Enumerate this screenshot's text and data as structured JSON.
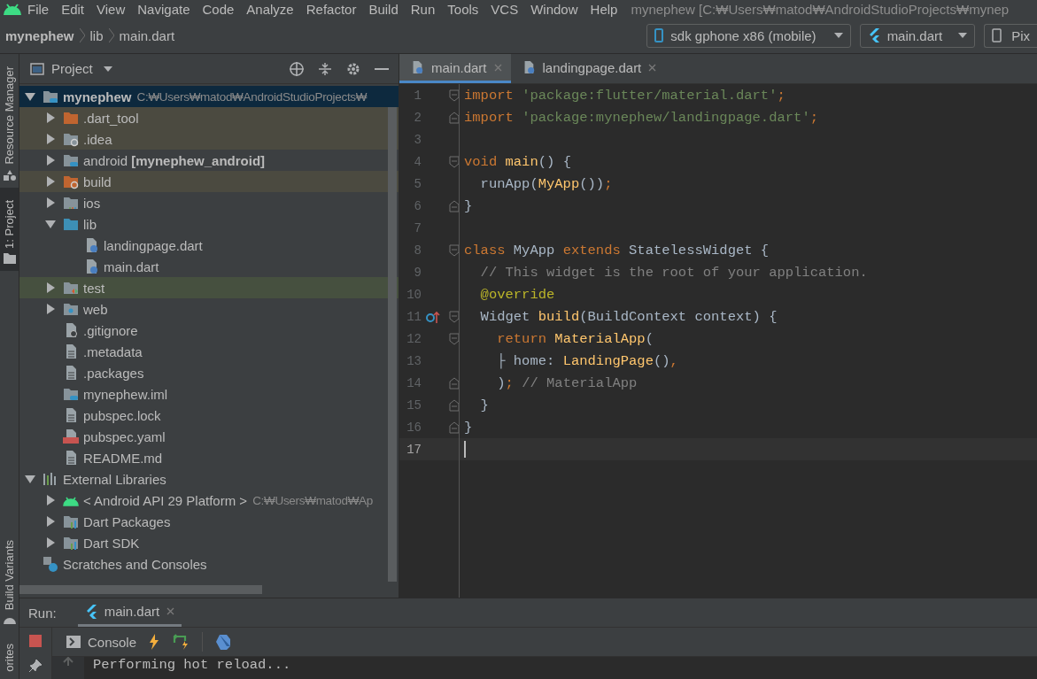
{
  "menu": [
    "File",
    "Edit",
    "View",
    "Navigate",
    "Code",
    "Analyze",
    "Refactor",
    "Build",
    "Run",
    "Tools",
    "VCS",
    "Window",
    "Help"
  ],
  "window": {
    "title": "mynephew [C:₩Users₩matod₩AndroidStudioProjects₩mynep"
  },
  "breadcrumbs": [
    "mynephew",
    "lib",
    "main.dart"
  ],
  "run_toolbar": {
    "device": "sdk gphone x86 (mobile)",
    "configuration": "main.dart",
    "next_label": "Pix"
  },
  "side_strip_top": [
    {
      "label": "Resource Manager",
      "kind": "resources",
      "selected": false
    },
    {
      "label": "1: Project",
      "kind": "project",
      "selected": true
    }
  ],
  "side_strip_bottom": [
    {
      "label": "Build Variants",
      "kind": "variants",
      "selected": false
    },
    {
      "label": "orites",
      "kind": "favorites",
      "selected": false
    }
  ],
  "project_panel": {
    "title": "Project",
    "tree": [
      {
        "label": "mynephew",
        "kind": "project-folder",
        "path": "C:₩Users₩matod₩AndroidStudioProjects₩",
        "expanded": true,
        "selected": true,
        "children": [
          {
            "label": ".dart_tool",
            "kind": "folder-excluded",
            "excluded": true,
            "test_source": false,
            "expanded": false,
            "selected": false
          },
          {
            "label": ".idea",
            "kind": "folder-config",
            "excluded": true,
            "test_source": false,
            "expanded": false,
            "selected": false
          },
          {
            "label": "android **[mynephew_android]**",
            "kind": "module-folder",
            "excluded": false,
            "test_source": false,
            "expanded": false,
            "selected": false
          },
          {
            "label": "build",
            "kind": "folder-build",
            "excluded": true,
            "test_source": false,
            "expanded": false,
            "selected": false
          },
          {
            "label": "ios",
            "kind": "folder-ios",
            "excluded": false,
            "test_source": false,
            "expanded": false,
            "selected": false
          },
          {
            "label": "lib",
            "kind": "folder",
            "excluded": false,
            "test_source": false,
            "expanded": true,
            "selected": false,
            "children": [
              {
                "label": "landingpage.dart",
                "kind": "dart-file",
                "selected": false
              },
              {
                "label": "main.dart",
                "kind": "dart-file",
                "selected": false
              }
            ]
          },
          {
            "label": "test",
            "kind": "folder-test",
            "excluded": false,
            "test_source": true,
            "expanded": false,
            "selected": false
          },
          {
            "label": "web",
            "kind": "folder-web",
            "excluded": false,
            "test_source": false,
            "expanded": false,
            "selected": false
          },
          {
            "label": ".gitignore",
            "kind": "ignore-file",
            "excluded": false,
            "test_source": false,
            "selected": false
          },
          {
            "label": ".metadata",
            "kind": "text-file",
            "excluded": false,
            "test_source": false,
            "selected": false
          },
          {
            "label": ".packages",
            "kind": "text-file",
            "excluded": false,
            "test_source": false,
            "selected": false
          },
          {
            "label": "mynephew.iml",
            "kind": "module-file",
            "excluded": false,
            "test_source": false,
            "selected": false
          },
          {
            "label": "pubspec.lock",
            "kind": "text-file",
            "excluded": false,
            "test_source": false,
            "selected": false
          },
          {
            "label": "pubspec.yaml",
            "kind": "yaml-file",
            "excluded": false,
            "test_source": false,
            "selected": false
          },
          {
            "label": "README.md",
            "kind": "text-file",
            "excluded": false,
            "test_source": false,
            "selected": false
          }
        ]
      },
      {
        "label": "External Libraries",
        "kind": "libraries",
        "expanded": true,
        "selected": false,
        "children": [
          {
            "label": "< Android API 29 Platform >",
            "kind": "android-sdk",
            "path": "C:₩Users₩matod₩Ap",
            "expanded": false,
            "selected": false
          },
          {
            "label": "Dart Packages",
            "kind": "library",
            "expanded": false,
            "selected": false
          },
          {
            "label": "Dart SDK",
            "kind": "library",
            "expanded": false,
            "selected": false
          }
        ]
      },
      {
        "label": "Scratches and Consoles",
        "kind": "scratches",
        "selected": false
      }
    ]
  },
  "editor": {
    "tabs": [
      {
        "label": "main.dart",
        "selected": true
      },
      {
        "label": "landingpage.dart",
        "selected": false
      }
    ],
    "lines": [
      {
        "number": "1",
        "fold_start": true,
        "fold_end": false,
        "current": false,
        "tokens": [
          {
            "kind": "kw",
            "text": "import "
          },
          {
            "kind": "str",
            "text": "'package:flutter/material.dart'"
          },
          {
            "kind": "kw",
            "text": ";"
          }
        ]
      },
      {
        "number": "2",
        "fold_start": false,
        "fold_end": true,
        "current": false,
        "tokens": [
          {
            "kind": "kw",
            "text": "import "
          },
          {
            "kind": "str",
            "text": "'package:mynephew/landingpage.dart'"
          },
          {
            "kind": "kw",
            "text": ";"
          }
        ]
      },
      {
        "number": "3",
        "fold_start": false,
        "fold_end": false,
        "current": false
      },
      {
        "number": "4",
        "fold_start": true,
        "fold_end": false,
        "current": false,
        "tokens": [
          {
            "kind": "kw",
            "text": "void "
          },
          {
            "kind": "fn",
            "text": "main"
          },
          {
            "kind": "plain",
            "text": "() {"
          }
        ]
      },
      {
        "number": "5",
        "fold_start": false,
        "fold_end": false,
        "current": false,
        "tokens": [
          {
            "kind": "plain",
            "text": "  runApp("
          },
          {
            "kind": "fn",
            "text": "MyApp"
          },
          {
            "kind": "plain",
            "text": "())"
          },
          {
            "kind": "kw",
            "text": ";"
          }
        ]
      },
      {
        "number": "6",
        "fold_start": false,
        "fold_end": true,
        "current": false,
        "tokens": [
          {
            "kind": "plain",
            "text": "}"
          }
        ]
      },
      {
        "number": "7",
        "fold_start": false,
        "fold_end": false,
        "current": false
      },
      {
        "number": "8",
        "fold_start": true,
        "fold_end": false,
        "current": false,
        "tokens": [
          {
            "kind": "kw",
            "text": "class "
          },
          {
            "kind": "plain",
            "text": "MyApp "
          },
          {
            "kind": "kw",
            "text": "extends "
          },
          {
            "kind": "plain",
            "text": "StatelessWidget {"
          }
        ]
      },
      {
        "number": "9",
        "fold_start": false,
        "fold_end": false,
        "current": false,
        "tokens": [
          {
            "kind": "cmt",
            "text": "  // This widget is the root of your application."
          }
        ]
      },
      {
        "number": "10",
        "fold_start": false,
        "fold_end": false,
        "current": false,
        "tokens": [
          {
            "kind": "ann",
            "text": "  @override"
          }
        ]
      },
      {
        "number": "11",
        "fold_start": true,
        "fold_end": false,
        "override": true,
        "current": false,
        "tokens": [
          {
            "kind": "plain",
            "text": "  Widget "
          },
          {
            "kind": "fn",
            "text": "build"
          },
          {
            "kind": "plain",
            "text": "(BuildContext context) {"
          }
        ]
      },
      {
        "number": "12",
        "fold_start": true,
        "fold_end": false,
        "current": false,
        "tokens": [
          {
            "kind": "kw",
            "text": "    return "
          },
          {
            "kind": "fn",
            "text": "MaterialApp"
          },
          {
            "kind": "plain",
            "text": "("
          }
        ]
      },
      {
        "number": "13",
        "fold_start": false,
        "fold_end": false,
        "current": false,
        "tokens": [
          {
            "kind": "plain",
            "text": "    ├ home: "
          },
          {
            "kind": "fn",
            "text": "LandingPage"
          },
          {
            "kind": "plain",
            "text": "()"
          },
          {
            "kind": "kw",
            "text": ","
          }
        ]
      },
      {
        "number": "14",
        "fold_start": false,
        "fold_end": true,
        "current": false,
        "tokens": [
          {
            "kind": "plain",
            "text": "    )"
          },
          {
            "kind": "kw",
            "text": "; "
          },
          {
            "kind": "cmt",
            "text": "// MaterialApp"
          }
        ]
      },
      {
        "number": "15",
        "fold_start": false,
        "fold_end": true,
        "current": false,
        "tokens": [
          {
            "kind": "plain",
            "text": "  }"
          }
        ]
      },
      {
        "number": "16",
        "fold_start": false,
        "fold_end": true,
        "current": false,
        "tokens": [
          {
            "kind": "plain",
            "text": "}"
          }
        ]
      },
      {
        "number": "17",
        "fold_start": false,
        "fold_end": false,
        "current": true
      }
    ]
  },
  "run_panel": {
    "label": "Run:",
    "tabs": [
      {
        "label": "main.dart",
        "selected": true
      }
    ],
    "console_tab": "Console",
    "output": [
      "Performing hot reload..."
    ]
  }
}
